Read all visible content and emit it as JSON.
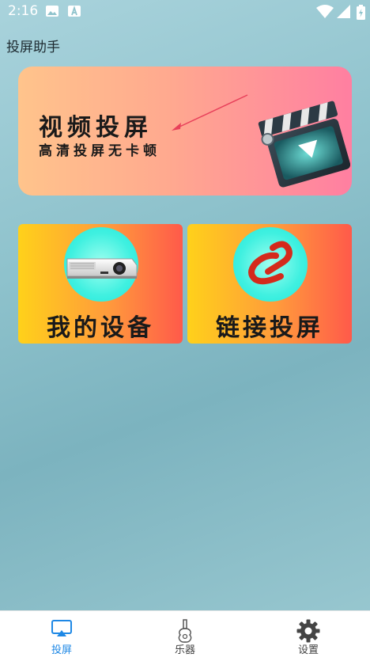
{
  "status_bar": {
    "time": "2:16"
  },
  "app": {
    "title": "投屏助手"
  },
  "banner": {
    "title": "视频投屏",
    "subtitle": "高清投屏无卡顿"
  },
  "cards": [
    {
      "label": "我的设备",
      "icon": "projector-icon"
    },
    {
      "label": "链接投屏",
      "icon": "link-icon"
    }
  ],
  "bottom_nav": [
    {
      "label": "投屏",
      "icon": "cast-icon",
      "active": true
    },
    {
      "label": "乐器",
      "icon": "guitar-icon",
      "active": false
    },
    {
      "label": "设置",
      "icon": "gear-icon",
      "active": false
    }
  ],
  "colors": {
    "active": "#1e88e5",
    "inactive": "#444444"
  }
}
